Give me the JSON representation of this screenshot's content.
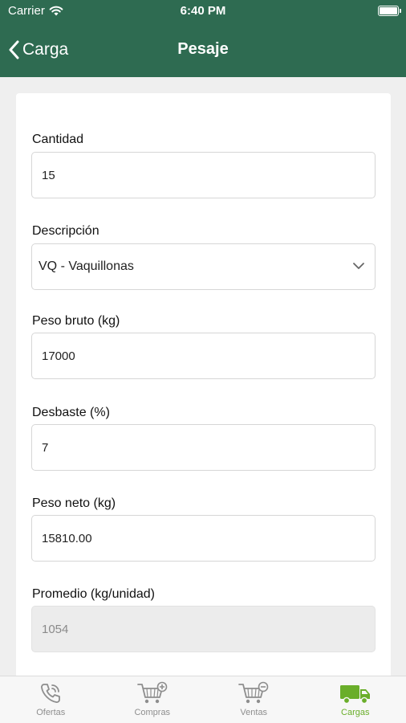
{
  "status": {
    "carrier": "Carrier",
    "time": "6:40 PM"
  },
  "nav": {
    "back_label": "Carga",
    "title": "Pesaje"
  },
  "form": {
    "cantidad": {
      "label": "Cantidad",
      "value": "15"
    },
    "descripcion": {
      "label": "Descripción",
      "value": "VQ - Vaquillonas"
    },
    "peso_bruto": {
      "label": "Peso bruto (kg)",
      "value": "17000"
    },
    "desbaste": {
      "label": "Desbaste (%)",
      "value": "7"
    },
    "peso_neto": {
      "label": "Peso neto (kg)",
      "value": "15810.00"
    },
    "promedio": {
      "label": "Promedio (kg/unidad)",
      "value": "1054"
    }
  },
  "tabs": [
    {
      "label": "Ofertas",
      "icon": "phone-icon"
    },
    {
      "label": "Compras",
      "icon": "cart-plus-icon"
    },
    {
      "label": "Ventas",
      "icon": "cart-minus-icon"
    },
    {
      "label": "Cargas",
      "icon": "truck-icon",
      "active": true
    }
  ],
  "colors": {
    "header": "#2e6b51",
    "active_tab": "#6aae2a",
    "inactive_tab": "#8e8e8e"
  }
}
